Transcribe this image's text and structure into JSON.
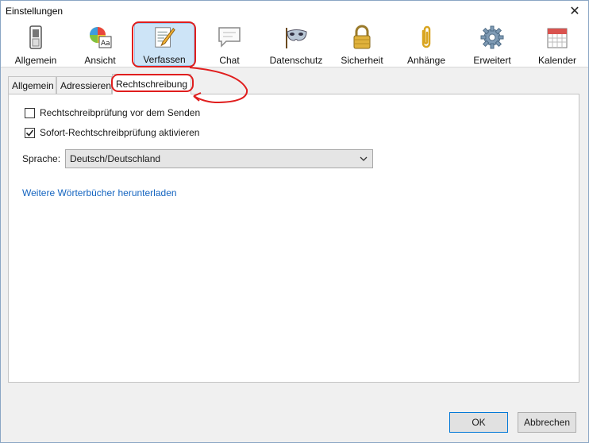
{
  "window": {
    "title": "Einstellungen",
    "close_glyph": "✕"
  },
  "toolbar": {
    "items": [
      {
        "label": "Allgemein",
        "icon": "switch-icon"
      },
      {
        "label": "Ansicht",
        "icon": "palette-icon"
      },
      {
        "label": "Verfassen",
        "icon": "compose-icon"
      },
      {
        "label": "Chat",
        "icon": "chat-bubble-icon"
      },
      {
        "label": "Datenschutz",
        "icon": "mask-icon"
      },
      {
        "label": "Sicherheit",
        "icon": "padlock-icon"
      },
      {
        "label": "Anhänge",
        "icon": "paperclip-icon"
      },
      {
        "label": "Erweitert",
        "icon": "gear-icon"
      },
      {
        "label": "Kalender",
        "icon": "calendar-icon"
      }
    ],
    "selected": "Verfassen"
  },
  "tabs": {
    "items": [
      {
        "label": "Allgemein"
      },
      {
        "label": "Adressieren"
      },
      {
        "label": "Rechtschreibung"
      }
    ],
    "active": "Rechtschreibung"
  },
  "spelling": {
    "check_before_send": {
      "label": "Rechtschreibprüfung vor dem Senden",
      "checked": false
    },
    "check_as_you_type": {
      "label": "Sofort-Rechtschreibprüfung aktivieren",
      "checked": true
    },
    "language_label": "Sprache:",
    "language_value": "Deutsch/Deutschland",
    "download_link": "Weitere Wörterbücher herunterladen"
  },
  "footer": {
    "ok_label": "OK",
    "cancel_label": "Abbrechen"
  },
  "colors": {
    "annotation_red": "#e01e1e",
    "accent_blue": "#0078d7",
    "link_blue": "#1565c0"
  }
}
